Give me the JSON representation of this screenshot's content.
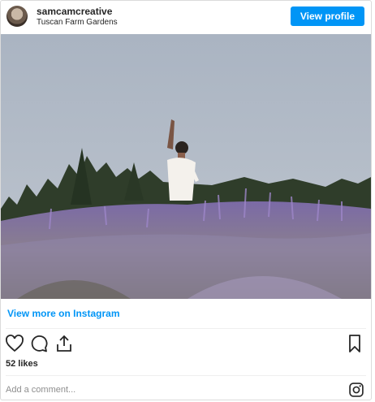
{
  "header": {
    "username": "samcamcreative",
    "location": "Tuscan Farm Gardens",
    "view_profile_label": "View profile"
  },
  "post": {
    "view_more_label": "View more on Instagram",
    "likes_text": "52 likes",
    "comment_placeholder": "Add a comment..."
  },
  "icons": {
    "like": "heart-icon",
    "comment": "comment-icon",
    "share": "share-icon",
    "save": "bookmark-icon",
    "instagram": "instagram-icon"
  },
  "colors": {
    "accent": "#0095f6",
    "text": "#262626",
    "muted": "#8e8e8e",
    "border": "#dbdbdb"
  }
}
